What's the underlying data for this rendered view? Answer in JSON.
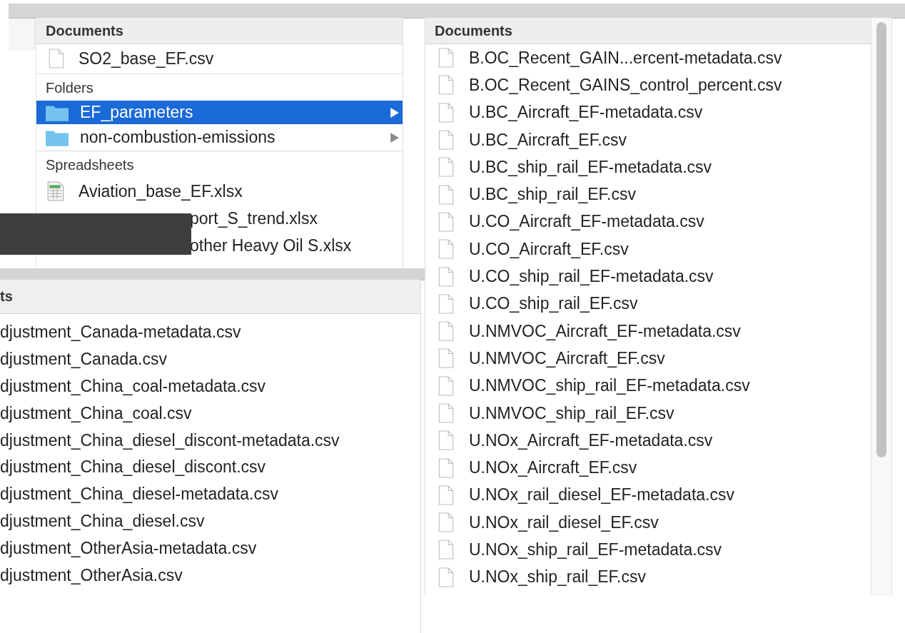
{
  "left_pane": {
    "header": "Documents",
    "documents": [
      {
        "name": "SO2_base_EF.csv"
      }
    ],
    "folders_label": "Folders",
    "folders": [
      {
        "name": "EF_parameters",
        "selected": true
      },
      {
        "name": "non-combustion-emissions",
        "selected": false
      }
    ],
    "spreadsheets_label": "Spreadsheets",
    "spreadsheets": [
      {
        "name": "Aviation_base_EF.xlsx",
        "covered": false
      },
      {
        "name": "port_S_trend.xlsx",
        "covered": true
      },
      {
        "name": "other Heavy Oil S.xlsx",
        "covered": true
      }
    ]
  },
  "bottom_pane": {
    "header": "ts",
    "files": [
      "djustment_Canada-metadata.csv",
      "djustment_Canada.csv",
      "djustment_China_coal-metadata.csv",
      "djustment_China_coal.csv",
      "djustment_China_diesel_discont-metadata.csv",
      "djustment_China_diesel_discont.csv",
      "djustment_China_diesel-metadata.csv",
      "djustment_China_diesel.csv",
      "djustment_OtherAsia-metadata.csv",
      "djustment_OtherAsia.csv"
    ]
  },
  "right_pane": {
    "header": "Documents",
    "files": [
      "B.OC_Recent_GAIN...ercent-metadata.csv",
      "B.OC_Recent_GAINS_control_percent.csv",
      "U.BC_Aircraft_EF-metadata.csv",
      "U.BC_Aircraft_EF.csv",
      "U.BC_ship_rail_EF-metadata.csv",
      "U.BC_ship_rail_EF.csv",
      "U.CO_Aircraft_EF-metadata.csv",
      "U.CO_Aircraft_EF.csv",
      "U.CO_ship_rail_EF-metadata.csv",
      "U.CO_ship_rail_EF.csv",
      "U.NMVOC_Aircraft_EF-metadata.csv",
      "U.NMVOC_Aircraft_EF.csv",
      "U.NMVOC_ship_rail_EF-metadata.csv",
      "U.NMVOC_ship_rail_EF.csv",
      "U.NOx_Aircraft_EF-metadata.csv",
      "U.NOx_Aircraft_EF.csv",
      "U.NOx_rail_diesel_EF-metadata.csv",
      "U.NOx_rail_diesel_EF.csv",
      "U.NOx_ship_rail_EF-metadata.csv",
      "U.NOx_ship_rail_EF.csv"
    ]
  }
}
